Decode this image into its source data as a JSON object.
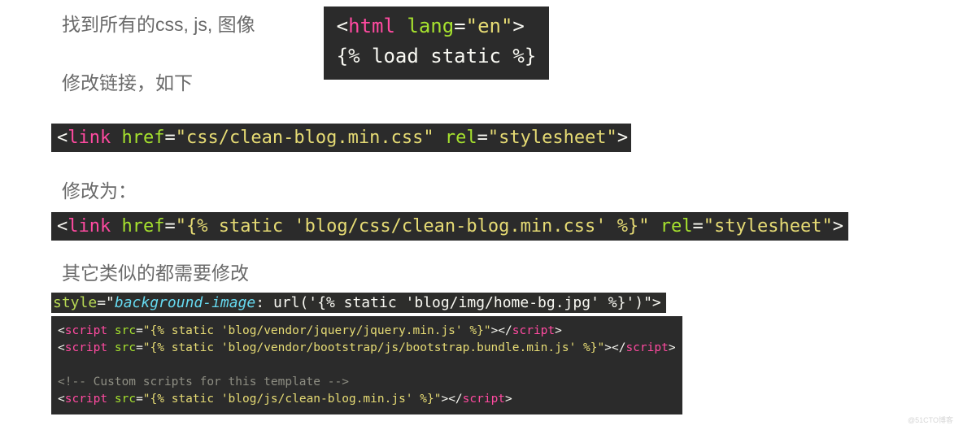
{
  "texts": {
    "line1": "找到所有的css, js, 图像",
    "line2": "修改链接，如下",
    "line3": "修改为：",
    "line4": "其它类似的都需要修改"
  },
  "code": {
    "top": {
      "lt": "<",
      "tag": "html",
      "sp": " ",
      "attr": "lang",
      "eq": "=",
      "val": "\"en\"",
      "gt": ">",
      "load": "{% load static %}"
    },
    "link1": {
      "lt": "<",
      "tag": "link",
      "sp": " ",
      "a1": "href",
      "eq": "=",
      "v1": "\"css/clean-blog.min.css\"",
      "sp2": " ",
      "a2": "rel",
      "v2": "\"stylesheet\"",
      "gt": ">"
    },
    "link2": {
      "lt": "<",
      "tag": "link",
      "sp": " ",
      "a1": "href",
      "eq": "=",
      "v1": "\"{% static 'blog/css/clean-blog.min.css' %}\"",
      "sp2": " ",
      "a2": "rel",
      "v2": "\"stylesheet\"",
      "gt": ">"
    },
    "style": {
      "attr": "style",
      "eq": "=\"",
      "prop": "background-image",
      "rest": ": url('{% static 'blog/img/home-bg.jpg' %}')\">"
    },
    "scripts": {
      "s1": {
        "lt": "<",
        "tag": "script",
        "sp": " ",
        "a": "src",
        "eq": "=",
        "v": "\"{% static 'blog/vendor/jquery/jquery.min.js' %}\"",
        "gt": ">",
        "lt2": "</",
        "tag2": "script",
        "gt2": ">"
      },
      "s2": {
        "lt": "<",
        "tag": "script",
        "sp": " ",
        "a": "src",
        "eq": "=",
        "v": "\"{% static 'blog/vendor/bootstrap/js/bootstrap.bundle.min.js' %}\"",
        "gt": ">",
        "lt2": "</",
        "tag2": "script",
        "gt2": ">"
      },
      "comment": "<!-- Custom scripts for this template -->",
      "s3": {
        "lt": "<",
        "tag": "script",
        "sp": " ",
        "a": "src",
        "eq": "=",
        "v": "\"{% static 'blog/js/clean-blog.min.js' %}\"",
        "gt": ">",
        "lt2": "</",
        "tag2": "script",
        "gt2": ">"
      }
    }
  },
  "watermark": "@51CTO博客"
}
